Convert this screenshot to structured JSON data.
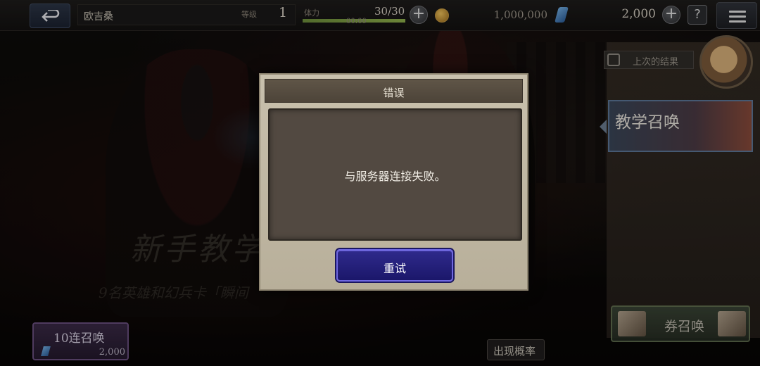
{
  "topbar": {
    "player_name": "欧吉桑",
    "level_label": "等级",
    "level": "1",
    "stamina_label": "体力",
    "stamina": "30/30",
    "stamina_fraction": 1.0,
    "stamina_timer": "00:00",
    "coins": "1,000,000",
    "gems": "2,000",
    "help_symbol": "?",
    "plus_symbol": "+"
  },
  "banner": {
    "title": "新手教学",
    "subtitle": "9名英雄和幻兵卡「瞬间"
  },
  "side": {
    "last_results_label": "上次的结果",
    "tutorial_summon_label": "教学召唤",
    "ticket_summon_label": "券召唤"
  },
  "bottom": {
    "ten_summon_label": "10连召唤",
    "ten_summon_cost": "2,000",
    "rate_label": "出现概率"
  },
  "modal": {
    "title": "错误",
    "message": "与服务器连接失败。",
    "retry_label": "重试"
  },
  "colors": {
    "retry_button": "#1b176a",
    "modal_frame": "#c8c0ad",
    "modal_body": "#524941"
  }
}
